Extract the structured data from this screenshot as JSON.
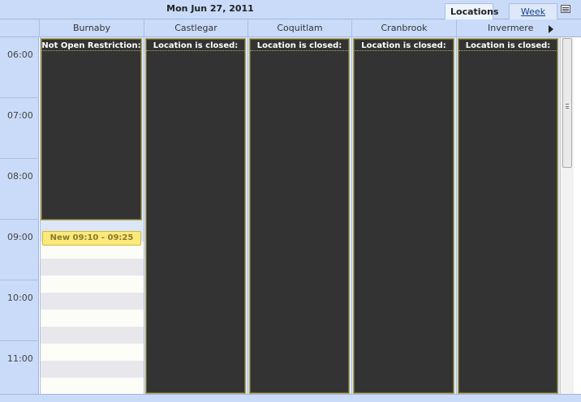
{
  "header": {
    "date_title": "Mon Jun 27, 2011",
    "tabs": [
      {
        "label": "Locations",
        "active": true
      },
      {
        "label": "Week",
        "active": false
      }
    ],
    "icons": {
      "menu": "menu-icon",
      "next": "chevron-right-icon"
    }
  },
  "columns": [
    {
      "name": "Burnaby",
      "status": "Not Open Restriction:"
    },
    {
      "name": "Castlegar",
      "status": "Location is closed:"
    },
    {
      "name": "Coquitlam",
      "status": "Location is closed:"
    },
    {
      "name": "Cranbrook",
      "status": "Location is closed:"
    },
    {
      "name": "Invermere",
      "status": "Location is closed:"
    }
  ],
  "hours": [
    "06:00",
    "07:00",
    "08:00",
    "09:00",
    "10:00",
    "11:00"
  ],
  "new_appointment": {
    "label": "New 09:10 - 09:25"
  },
  "colors": {
    "closed_block": "#333333",
    "header_bg": "#c9dbf8",
    "new_appointment": "#fbe97a"
  }
}
